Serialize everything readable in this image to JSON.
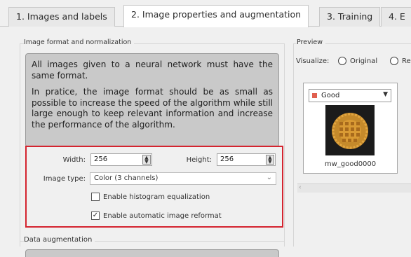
{
  "tabs": [
    {
      "label": "1. Images and labels"
    },
    {
      "label": "2. Image properties and augmentation"
    },
    {
      "label": "3. Training"
    },
    {
      "label": "4. E"
    }
  ],
  "format_group": {
    "title": "Image format and normalization",
    "description_p1": "All images given to a neural network must have the same format.",
    "description_p2": "In pratice, the image format should be as small as possible to increase the speed of the algorithm while still large enough to keep relevant information and increase the performance of the algorithm.",
    "width_label": "Width:",
    "width_value": "256",
    "height_label": "Height:",
    "height_value": "256",
    "image_type_label": "Image type:",
    "image_type_value": "Color (3 channels)",
    "hist_eq_label": "Enable histogram equalization",
    "hist_eq_checked": false,
    "auto_reformat_label": "Enable automatic image reformat",
    "auto_reformat_checked": true,
    "highlight_color": "#d4242f"
  },
  "augmentation_group": {
    "title": "Data augmentation"
  },
  "preview": {
    "title": "Preview",
    "visualize_label": "Visualize:",
    "radio_original": "Original",
    "radio_partial": "Re",
    "class_value": "Good",
    "class_color": "#e06050",
    "thumb_caption": "mw_good0000"
  }
}
